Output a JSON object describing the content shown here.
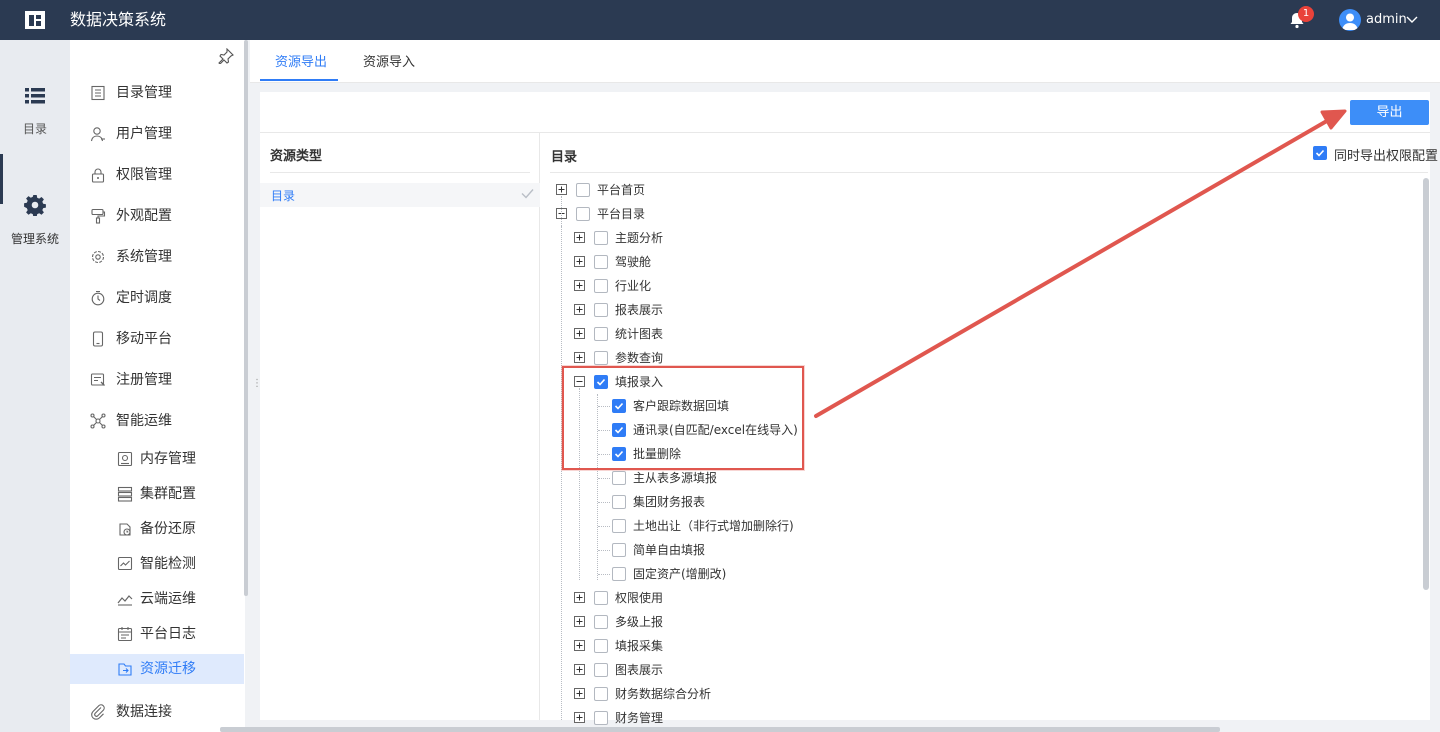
{
  "header": {
    "app_title": "数据决策系统",
    "notification_count": "1",
    "user_name": "admin"
  },
  "rail": {
    "items": [
      {
        "label": "目录",
        "icon": "list-icon"
      },
      {
        "label": "管理系统",
        "icon": "gear-icon"
      }
    ]
  },
  "menu": {
    "items": [
      {
        "label": "目录管理",
        "icon": "catalog-icon"
      },
      {
        "label": "用户管理",
        "icon": "user-icon"
      },
      {
        "label": "权限管理",
        "icon": "lock-icon"
      },
      {
        "label": "外观配置",
        "icon": "brush-icon"
      },
      {
        "label": "系统管理",
        "icon": "gear-icon"
      },
      {
        "label": "定时调度",
        "icon": "timer-icon"
      },
      {
        "label": "移动平台",
        "icon": "mobile-icon"
      },
      {
        "label": "注册管理",
        "icon": "register-icon"
      },
      {
        "label": "智能运维",
        "icon": "ops-icon"
      },
      {
        "label": "内存管理",
        "icon": "memory-icon"
      },
      {
        "label": "集群配置",
        "icon": "cluster-icon"
      },
      {
        "label": "备份还原",
        "icon": "backup-icon"
      },
      {
        "label": "智能检测",
        "icon": "monitor-icon"
      },
      {
        "label": "云端运维",
        "icon": "cloud-ops-icon"
      },
      {
        "label": "平台日志",
        "icon": "log-icon"
      },
      {
        "label": "资源迁移",
        "icon": "migrate-icon"
      },
      {
        "label": "数据连接",
        "icon": "link-icon"
      }
    ]
  },
  "tabs": [
    {
      "label": "资源导出"
    },
    {
      "label": "资源导入"
    }
  ],
  "toolbar": {
    "export_label": "导出"
  },
  "resource_type": {
    "title": "资源类型",
    "items": [
      {
        "label": "目录",
        "selected": true
      }
    ]
  },
  "catalog": {
    "title": "目录",
    "sync_permission_label": "同时导出权限配置",
    "sync_permission_checked": true,
    "tree": [
      {
        "label": "平台首页",
        "toggle": "plus",
        "checked": false
      },
      {
        "label": "平台目录",
        "toggle": "minus",
        "checked": false
      },
      {
        "label": "主题分析",
        "toggle": "plus",
        "checked": false
      },
      {
        "label": "驾驶舱",
        "toggle": "plus",
        "checked": false
      },
      {
        "label": "行业化",
        "toggle": "plus",
        "checked": false
      },
      {
        "label": "报表展示",
        "toggle": "plus",
        "checked": false
      },
      {
        "label": "统计图表",
        "toggle": "plus",
        "checked": false
      },
      {
        "label": "参数查询",
        "toggle": "plus",
        "checked": false
      },
      {
        "label": "填报录入",
        "toggle": "minus",
        "checked": true
      },
      {
        "label": "客户跟踪数据回填",
        "toggle": "",
        "checked": true
      },
      {
        "label": "通讯录(自匹配/excel在线导入)",
        "toggle": "",
        "checked": true
      },
      {
        "label": "批量删除",
        "toggle": "",
        "checked": true
      },
      {
        "label": "主从表多源填报",
        "toggle": "",
        "checked": false
      },
      {
        "label": "集团财务报表",
        "toggle": "",
        "checked": false
      },
      {
        "label": "土地出让（非行式增加删除行)",
        "toggle": "",
        "checked": false
      },
      {
        "label": "简单自由填报",
        "toggle": "",
        "checked": false
      },
      {
        "label": "固定资产(增删改)",
        "toggle": "",
        "checked": false
      },
      {
        "label": "权限使用",
        "toggle": "plus",
        "checked": false
      },
      {
        "label": "多级上报",
        "toggle": "plus",
        "checked": false
      },
      {
        "label": "填报采集",
        "toggle": "plus",
        "checked": false
      },
      {
        "label": "图表展示",
        "toggle": "plus",
        "checked": false
      },
      {
        "label": "财务数据综合分析",
        "toggle": "plus",
        "checked": false
      },
      {
        "label": "财务管理",
        "toggle": "plus",
        "checked": false
      }
    ]
  },
  "colors": {
    "topbar": "#2b3a52",
    "accent": "#2f7cf6",
    "annotation": "#e0574f"
  }
}
